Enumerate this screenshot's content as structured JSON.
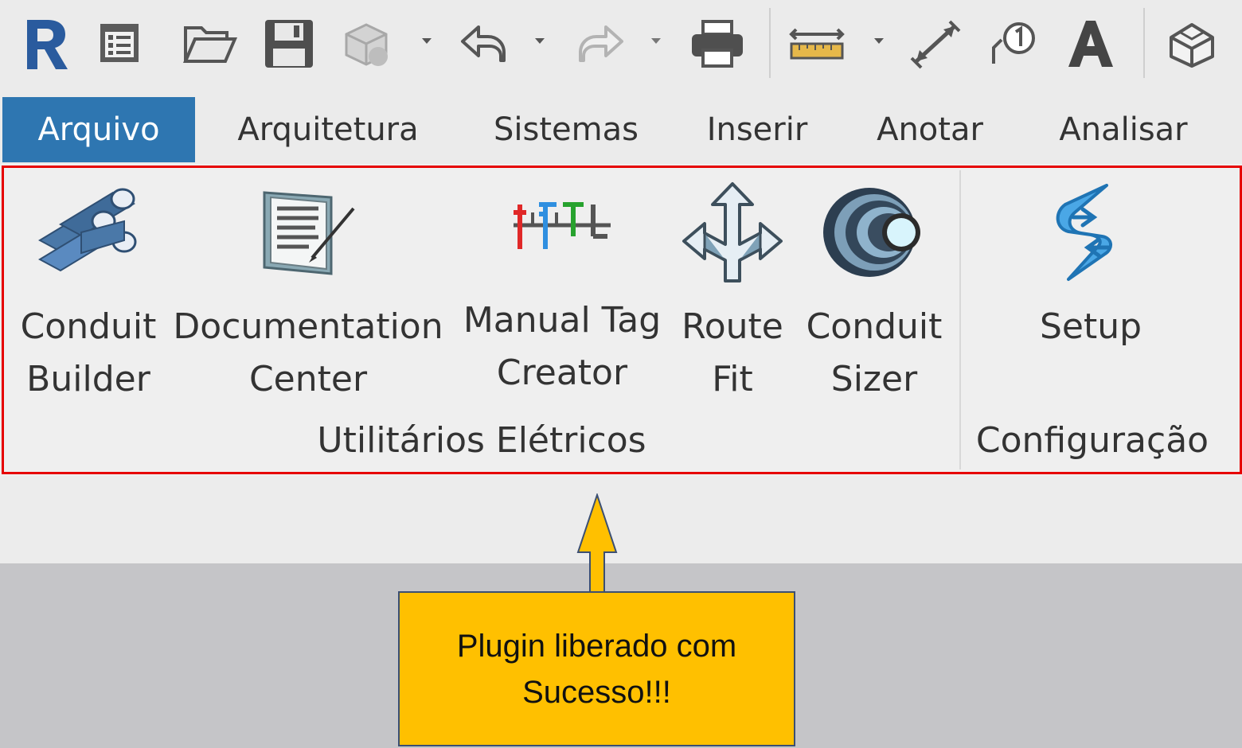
{
  "quick_access": {
    "icons": [
      "revit-logo-icon",
      "info-icon",
      "open-folder-icon",
      "save-icon",
      "sync-icon",
      "undo-icon",
      "redo-icon",
      "print-icon",
      "measure-icon",
      "aligned-dimension-icon",
      "tag-icon",
      "text-icon",
      "3d-view-icon"
    ]
  },
  "tabs": [
    {
      "label": "Arquivo",
      "active": true
    },
    {
      "label": "Arquitetura"
    },
    {
      "label": "Sistemas"
    },
    {
      "label": "Inserir"
    },
    {
      "label": "Anotar"
    },
    {
      "label": "Analisar"
    }
  ],
  "ribbon": {
    "panels": [
      {
        "label": "Utilitários Elétricos",
        "buttons": [
          {
            "label": "Conduit\nBuilder",
            "icon": "conduits-icon"
          },
          {
            "label": "Documentation\nCenter",
            "icon": "document-icon"
          },
          {
            "label": "Manual Tag\nCreator",
            "icon": "tag-creator-icon"
          },
          {
            "label": "Route\nFit",
            "icon": "route-arrows-icon"
          },
          {
            "label": "Conduit\nSizer",
            "icon": "conduit-sizer-icon"
          }
        ]
      },
      {
        "label": "Configuração",
        "buttons": [
          {
            "label": "Setup",
            "icon": "setup-icon"
          }
        ]
      }
    ]
  },
  "callout": {
    "text": "Plugin liberado com Sucesso!!!"
  },
  "colors": {
    "active_tab": "#2e76b1",
    "highlight_border": "#e60000",
    "callout_fill": "#ffc000",
    "callout_border": "#3b4f73"
  }
}
